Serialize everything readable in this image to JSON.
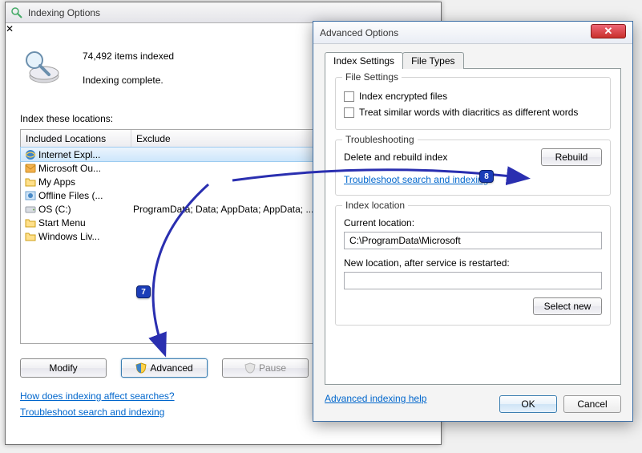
{
  "indexing_window": {
    "title": "Indexing Options",
    "items_indexed_line": "74,492 items indexed",
    "status_line": "Indexing complete.",
    "index_locations_label": "Index these locations:",
    "columns": {
      "included": "Included Locations",
      "exclude": "Exclude"
    },
    "rows": [
      {
        "name": "Internet Expl...",
        "exclude": "",
        "icon": "ie-icon",
        "selected": true
      },
      {
        "name": "Microsoft Ou...",
        "exclude": "",
        "icon": "outlook-icon"
      },
      {
        "name": "My Apps",
        "exclude": "",
        "icon": "folder-icon"
      },
      {
        "name": "Offline Files (...",
        "exclude": "",
        "icon": "offline-files-icon"
      },
      {
        "name": "OS (C:)",
        "exclude": "ProgramData; Data; AppData; AppData; ...",
        "icon": "drive-icon"
      },
      {
        "name": "Start Menu",
        "exclude": "",
        "icon": "folder-icon"
      },
      {
        "name": "Windows Liv...",
        "exclude": "",
        "icon": "folder-icon"
      }
    ],
    "buttons": {
      "modify": "Modify",
      "advanced": "Advanced",
      "pause": "Pause"
    },
    "links": {
      "affect": "How does indexing affect searches?",
      "troubleshoot": "Troubleshoot search and indexing"
    }
  },
  "advanced_window": {
    "title": "Advanced Options",
    "tabs": {
      "index_settings": "Index Settings",
      "file_types": "File Types"
    },
    "file_settings_group": {
      "legend": "File Settings",
      "encrypt": "Index encrypted files",
      "diacritics": "Treat similar words with diacritics as different words"
    },
    "troubleshooting_group": {
      "legend": "Troubleshooting",
      "rebuild_label": "Delete and rebuild index",
      "rebuild_btn": "Rebuild",
      "troubleshoot_link": "Troubleshoot search and indexing"
    },
    "index_location_group": {
      "legend": "Index location",
      "current_label": "Current location:",
      "current_value": "C:\\ProgramData\\Microsoft",
      "new_label": "New location, after service is restarted:",
      "new_value": "",
      "select_new_btn": "Select new"
    },
    "help_link": "Advanced indexing help",
    "buttons": {
      "ok": "OK",
      "cancel": "Cancel"
    }
  },
  "callouts": {
    "step7": "7",
    "step8": "8"
  }
}
